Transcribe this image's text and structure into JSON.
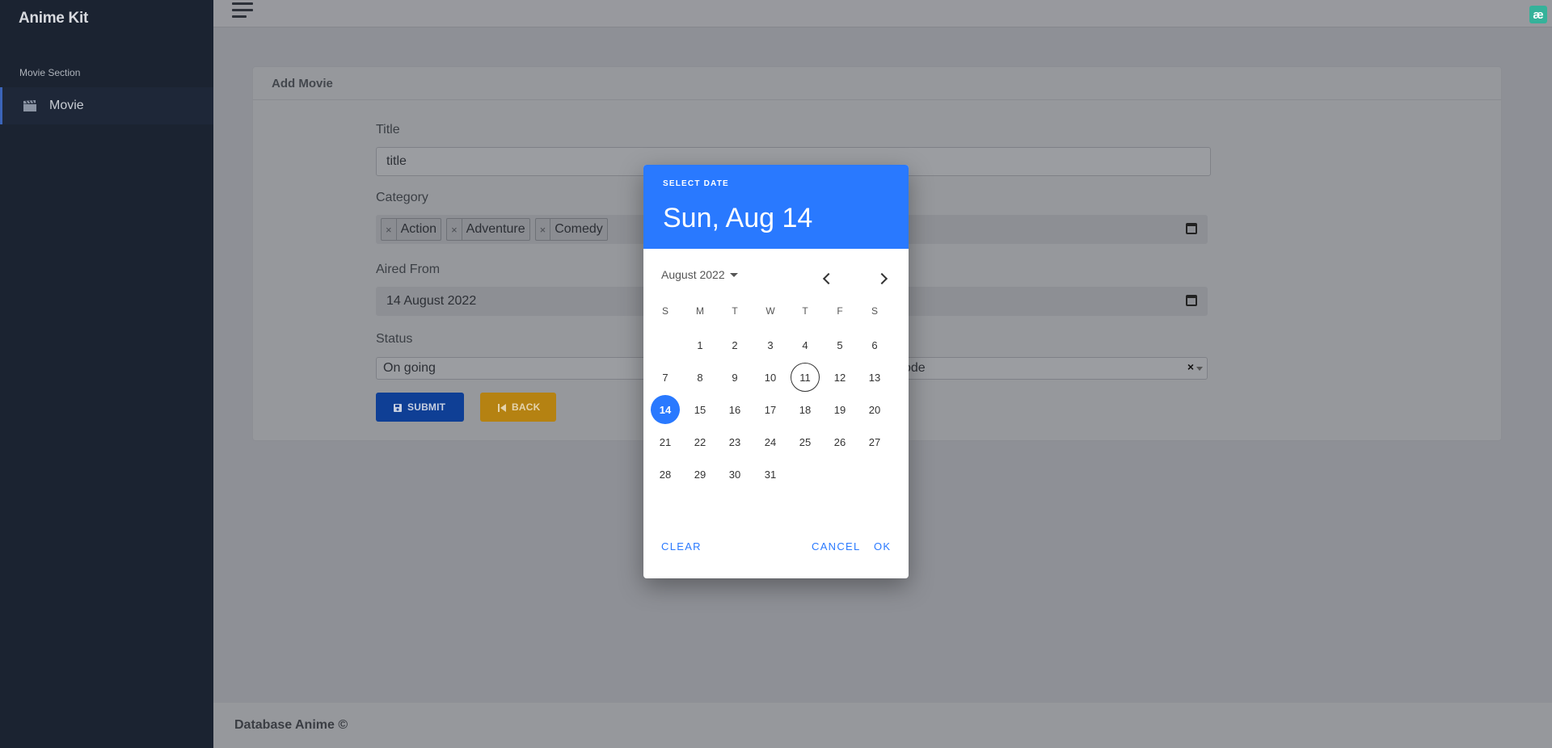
{
  "app": {
    "brand": "Anime Kit"
  },
  "sidebar": {
    "section_label": "Movie Section",
    "items": [
      {
        "label": "Movie",
        "icon": "clapperboard-icon"
      }
    ]
  },
  "topbar": {
    "user_badge": "æ"
  },
  "form": {
    "card_title": "Add Movie",
    "title_label": "Title",
    "title_value": "title",
    "category_label": "Category",
    "categories": [
      "Action",
      "Adventure",
      "Comedy"
    ],
    "aired_from_label": "Aired From",
    "aired_from_value": "14 August 2022",
    "status_label": "Status",
    "status_value": "On going",
    "partial_select_value": "ode",
    "submit_label": "SUBMIT",
    "back_label": "BACK"
  },
  "footer": {
    "text": "Database Anime ©"
  },
  "datepicker": {
    "header_label": "SELECT DATE",
    "selected_display": "Sun, Aug 14",
    "month_label": "August 2022",
    "weekdays": [
      "S",
      "M",
      "T",
      "W",
      "T",
      "F",
      "S"
    ],
    "first_weekday_index": 1,
    "days_in_month": 31,
    "today": 11,
    "selected": 14,
    "clear_label": "CLEAR",
    "cancel_label": "CANCEL",
    "ok_label": "OK"
  },
  "colors": {
    "accent": "#2979ff",
    "sidebar_bg": "#1b2331",
    "submit_bg": "#0f3f95",
    "back_bg": "#b58212"
  }
}
